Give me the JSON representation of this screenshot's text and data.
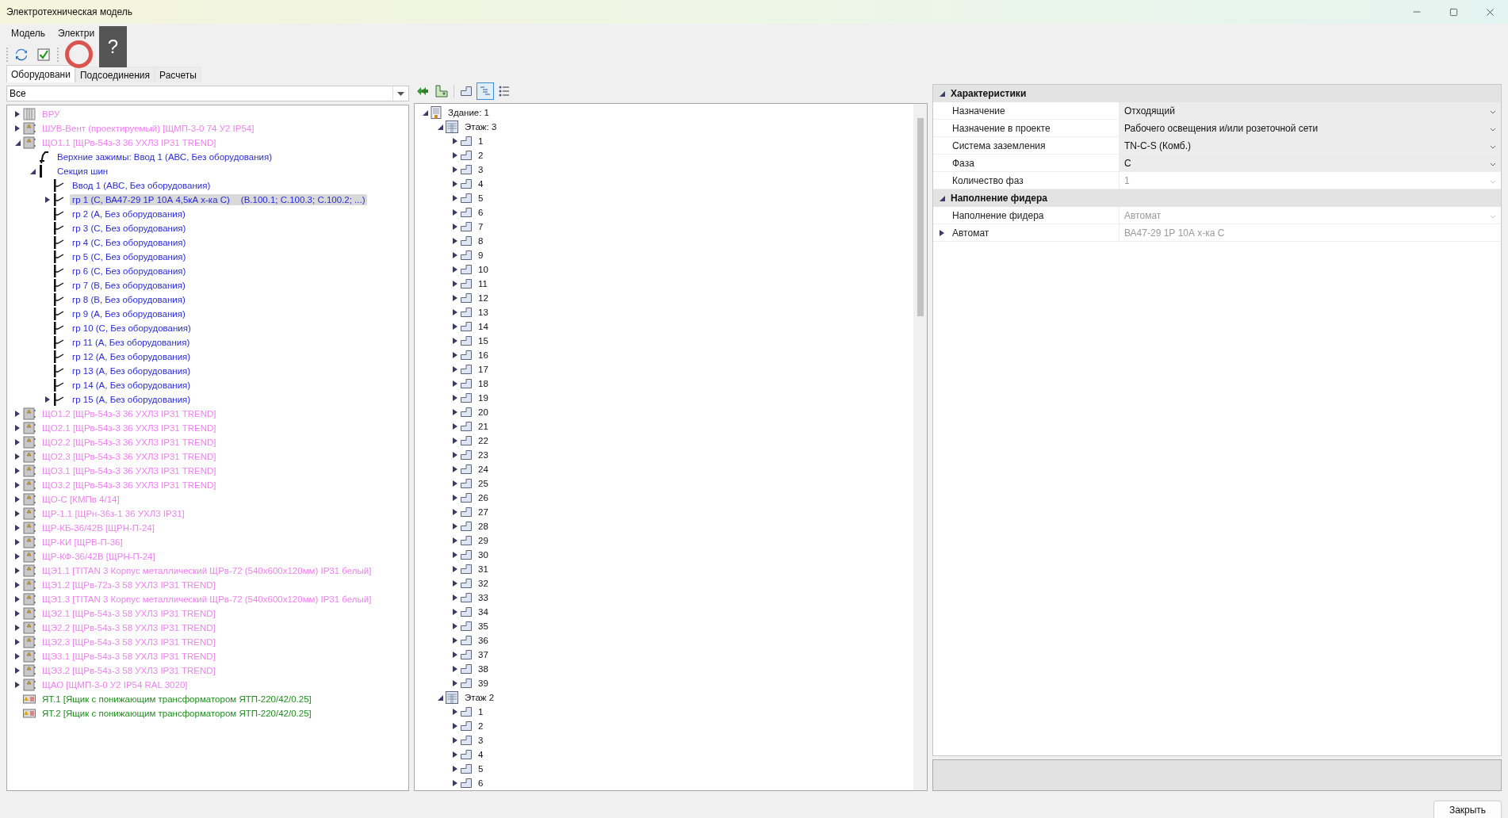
{
  "window": {
    "title": "Электротехническая модель"
  },
  "menu": [
    "Модель",
    "Электри"
  ],
  "overlay": {
    "glyph": "?"
  },
  "tabs": [
    {
      "label": "Оборудовани",
      "selected": true
    },
    {
      "label": "Подсоединения",
      "selected": false
    },
    {
      "label": "Расчеты",
      "selected": false
    }
  ],
  "filter": {
    "value": "Все"
  },
  "equipment_tree": [
    {
      "kind": "switchboard",
      "label": "ВРУ",
      "expanded": false,
      "selected": false
    },
    {
      "kind": "cabinet",
      "label": "ШУВ-Вент (проектируемый) [ЩМП-3-0 74 У2 IP54]",
      "expanded": false,
      "selected": false
    },
    {
      "kind": "cabinet",
      "label": "ЩО1.1 [ЩРв-54з-3 36 УХЛ3 IP31 TREND]",
      "expanded": true,
      "selected": false,
      "children": [
        {
          "kind": "terminal",
          "label": "Верхние зажимы: Ввод 1 (АВС, Без оборудования)",
          "selected": false
        },
        {
          "kind": "busbar",
          "label": "Секция шин",
          "expanded": true,
          "selected": false,
          "children": [
            {
              "kind": "feeder",
              "label": "Ввод 1 (АВС, Без оборудования)",
              "selected": false
            },
            {
              "kind": "feeder",
              "label": "гр 1 (С, ВА47-29 1Р 10А 4,5кА х-ка С)",
              "note": "(B.100.1; C.100.3; C.100.2; ...)",
              "expanded": false,
              "selected": true
            },
            {
              "kind": "feeder",
              "label": "гр 2 (А, Без оборудования)",
              "selected": false
            },
            {
              "kind": "feeder",
              "label": "гр 3 (С, Без оборудования)",
              "selected": false
            },
            {
              "kind": "feeder",
              "label": "гр 4 (С, Без оборудования)",
              "selected": false
            },
            {
              "kind": "feeder",
              "label": "гр 5 (С, Без оборудования)",
              "selected": false
            },
            {
              "kind": "feeder",
              "label": "гр 6 (С, Без оборудования)",
              "selected": false
            },
            {
              "kind": "feeder",
              "label": "гр 7 (В, Без оборудования)",
              "selected": false
            },
            {
              "kind": "feeder",
              "label": "гр 8 (В, Без оборудования)",
              "selected": false
            },
            {
              "kind": "feeder",
              "label": "гр 9 (А, Без оборудования)",
              "selected": false
            },
            {
              "kind": "feeder",
              "label": "гр 10 (С, Без оборудования)",
              "selected": false
            },
            {
              "kind": "feeder",
              "label": "гр 11 (А, Без оборудования)",
              "selected": false
            },
            {
              "kind": "feeder",
              "label": "гр 12 (А, Без оборудования)",
              "selected": false
            },
            {
              "kind": "feeder",
              "label": "гр 13 (А, Без оборудования)",
              "selected": false
            },
            {
              "kind": "feeder",
              "label": "гр 14 (А, Без оборудования)",
              "selected": false
            },
            {
              "kind": "feeder",
              "label": "гр 15 (А, Без оборудования)",
              "expanded": false,
              "selected": false
            }
          ]
        }
      ]
    },
    {
      "kind": "cabinet",
      "label": "ЩО1.2 [ЩРв-54з-3 36 УХЛ3 IP31 TREND]",
      "expanded": false,
      "selected": false
    },
    {
      "kind": "cabinet",
      "label": "ЩО2.1 [ЩРв-54з-3 36 УХЛ3 IP31 TREND]",
      "expanded": false,
      "selected": false
    },
    {
      "kind": "cabinet",
      "label": "ЩО2.2 [ЩРв-54з-3 36 УХЛ3 IP31 TREND]",
      "expanded": false,
      "selected": false
    },
    {
      "kind": "cabinet",
      "label": "ЩО2.3 [ЩРв-54з-3 36 УХЛ3 IP31 TREND]",
      "expanded": false,
      "selected": false
    },
    {
      "kind": "cabinet",
      "label": "ЩО3.1 [ЩРв-54з-3 36 УХЛ3 IP31 TREND]",
      "expanded": false,
      "selected": false
    },
    {
      "kind": "cabinet",
      "label": "ЩО3.2 [ЩРв-54з-3 36 УХЛ3 IP31 TREND]",
      "expanded": false,
      "selected": false
    },
    {
      "kind": "cabinet",
      "label": "ЩО-С [КМПв 4/14]",
      "expanded": false,
      "selected": false
    },
    {
      "kind": "cabinet",
      "label": "ЩР-1.1 [ЩРн-36з-1 36 УХЛ3 IP31]",
      "expanded": false,
      "selected": false
    },
    {
      "kind": "cabinet",
      "label": "ЩР-КБ-36/42В [ЩРН-П-24]",
      "expanded": false,
      "selected": false
    },
    {
      "kind": "cabinet",
      "label": "ЩР-КИ [ЩРВ-П-36]",
      "expanded": false,
      "selected": false
    },
    {
      "kind": "cabinet",
      "label": "ЩР-КФ-36/42В [ЩРН-П-24]",
      "expanded": false,
      "selected": false
    },
    {
      "kind": "cabinet",
      "label": "ЩЭ1.1 [TITAN 3 Корпус металлический ЩРв-72 (540х600х120мм) IP31 белый]",
      "expanded": false,
      "selected": false
    },
    {
      "kind": "cabinet",
      "label": "ЩЭ1.2 [ЩРв-72з-3 58 УХЛ3 IP31 TREND]",
      "expanded": false,
      "selected": false
    },
    {
      "kind": "cabinet",
      "label": "ЩЭ1.3 [TITAN 3 Корпус металлический ЩРв-72 (540х600х120мм) IP31 белый]",
      "expanded": false,
      "selected": false
    },
    {
      "kind": "cabinet",
      "label": "ЩЭ2.1 [ЩРв-54з-3 58 УХЛ3 IP31 TREND]",
      "expanded": false,
      "selected": false
    },
    {
      "kind": "cabinet",
      "label": "ЩЭ2.2 [ЩРв-54з-3 58 УХЛ3 IP31 TREND]",
      "expanded": false,
      "selected": false
    },
    {
      "kind": "cabinet",
      "label": "ЩЭ2.3 [ЩРв-54з-3 58 УХЛ3 IP31 TREND]",
      "expanded": false,
      "selected": false
    },
    {
      "kind": "cabinet",
      "label": "ЩЭ3.1 [ЩРв-54з-3 58 УХЛ3 IP31 TREND]",
      "expanded": false,
      "selected": false
    },
    {
      "kind": "cabinet",
      "label": "ЩЭ3.2 [ЩРв-54з-3 58 УХЛ3 IP31 TREND]",
      "expanded": false,
      "selected": false
    },
    {
      "kind": "cabinet",
      "label": "ЩАО [ЩМП-3-0 У2 IP54 RAL 3020]",
      "expanded": false,
      "selected": false
    },
    {
      "kind": "transformer",
      "label": "ЯТ.1 [Ящик с понижающим трансформатором ЯТП-220/42/0.25]",
      "selected": false
    },
    {
      "kind": "transformer",
      "label": "ЯТ.2 [Ящик с понижающим трансформатором ЯТП-220/42/0.25]",
      "selected": false
    }
  ],
  "building_toolbar": [
    {
      "kind": "collapse",
      "selected": false
    },
    {
      "kind": "add",
      "selected": false
    },
    {
      "kind": "room",
      "selected": false
    },
    {
      "kind": "tree",
      "selected": true
    },
    {
      "kind": "list",
      "selected": false
    }
  ],
  "building_tree": [
    {
      "kind": "building",
      "label": "Здание: 1",
      "expanded": true,
      "selected": false,
      "children": [
        {
          "kind": "floor",
          "label": "Этаж: 3",
          "expanded": true,
          "selected": false,
          "children": [
            {
              "kind": "room",
              "label": "1",
              "expanded": false,
              "selected": false
            },
            {
              "kind": "room",
              "label": "2",
              "expanded": false,
              "selected": false
            },
            {
              "kind": "room",
              "label": "3",
              "expanded": false,
              "selected": false
            },
            {
              "kind": "room",
              "label": "4",
              "expanded": false,
              "selected": false
            },
            {
              "kind": "room",
              "label": "5",
              "expanded": false,
              "selected": false
            },
            {
              "kind": "room",
              "label": "6",
              "expanded": false,
              "selected": false
            },
            {
              "kind": "room",
              "label": "7",
              "expanded": false,
              "selected": false
            },
            {
              "kind": "room",
              "label": "8",
              "expanded": false,
              "selected": false
            },
            {
              "kind": "room",
              "label": "9",
              "expanded": false,
              "selected": false
            },
            {
              "kind": "room",
              "label": "10",
              "expanded": false,
              "selected": false
            },
            {
              "kind": "room",
              "label": "11",
              "expanded": false,
              "selected": false
            },
            {
              "kind": "room",
              "label": "12",
              "expanded": false,
              "selected": false
            },
            {
              "kind": "room",
              "label": "13",
              "expanded": false,
              "selected": false
            },
            {
              "kind": "room",
              "label": "14",
              "expanded": false,
              "selected": false
            },
            {
              "kind": "room",
              "label": "15",
              "expanded": false,
              "selected": false
            },
            {
              "kind": "room",
              "label": "16",
              "expanded": false,
              "selected": false
            },
            {
              "kind": "room",
              "label": "17",
              "expanded": false,
              "selected": false
            },
            {
              "kind": "room",
              "label": "18",
              "expanded": false,
              "selected": false
            },
            {
              "kind": "room",
              "label": "19",
              "expanded": false,
              "selected": false
            },
            {
              "kind": "room",
              "label": "20",
              "expanded": false,
              "selected": false
            },
            {
              "kind": "room",
              "label": "21",
              "expanded": false,
              "selected": false
            },
            {
              "kind": "room",
              "label": "22",
              "expanded": false,
              "selected": false
            },
            {
              "kind": "room",
              "label": "23",
              "expanded": false,
              "selected": false
            },
            {
              "kind": "room",
              "label": "24",
              "expanded": false,
              "selected": false
            },
            {
              "kind": "room",
              "label": "25",
              "expanded": false,
              "selected": false
            },
            {
              "kind": "room",
              "label": "26",
              "expanded": false,
              "selected": false
            },
            {
              "kind": "room",
              "label": "27",
              "expanded": false,
              "selected": false
            },
            {
              "kind": "room",
              "label": "28",
              "expanded": false,
              "selected": false
            },
            {
              "kind": "room",
              "label": "29",
              "expanded": false,
              "selected": false
            },
            {
              "kind": "room",
              "label": "30",
              "expanded": false,
              "selected": false
            },
            {
              "kind": "room",
              "label": "31",
              "expanded": false,
              "selected": false
            },
            {
              "kind": "room",
              "label": "32",
              "expanded": false,
              "selected": false
            },
            {
              "kind": "room",
              "label": "33",
              "expanded": false,
              "selected": false
            },
            {
              "kind": "room",
              "label": "34",
              "expanded": false,
              "selected": false
            },
            {
              "kind": "room",
              "label": "35",
              "expanded": false,
              "selected": false
            },
            {
              "kind": "room",
              "label": "36",
              "expanded": false,
              "selected": false
            },
            {
              "kind": "room",
              "label": "37",
              "expanded": false,
              "selected": false
            },
            {
              "kind": "room",
              "label": "38",
              "expanded": false,
              "selected": false
            },
            {
              "kind": "room",
              "label": "39",
              "expanded": false,
              "selected": false
            }
          ]
        },
        {
          "kind": "floor",
          "label": "Этаж 2",
          "expanded": true,
          "selected": false,
          "children": [
            {
              "kind": "room",
              "label": "1",
              "expanded": false,
              "selected": false
            },
            {
              "kind": "room",
              "label": "2",
              "expanded": false,
              "selected": false
            },
            {
              "kind": "room",
              "label": "3",
              "expanded": false,
              "selected": false
            },
            {
              "kind": "room",
              "label": "4",
              "expanded": false,
              "selected": false
            },
            {
              "kind": "room",
              "label": "5",
              "expanded": false,
              "selected": false
            },
            {
              "kind": "room",
              "label": "6",
              "expanded": false,
              "selected": false
            }
          ]
        }
      ]
    }
  ],
  "properties": [
    {
      "category": "Характеристики",
      "expanded": true,
      "rows": [
        {
          "label": "Назначение",
          "value": "Отходящий",
          "disabled": false
        },
        {
          "label": "Назначение в проекте",
          "value": "Рабочего освещения и/или розеточной сети",
          "disabled": false
        },
        {
          "label": "Система заземления",
          "value": "TN-C-S (Комб.)",
          "disabled": false
        },
        {
          "label": "Фаза",
          "value": "С",
          "disabled": false
        },
        {
          "label": "Количество фаз",
          "value": "1",
          "disabled": true
        }
      ]
    },
    {
      "category": "Наполнение фидера",
      "expanded": true,
      "rows": [
        {
          "label": "Наполнение фидера",
          "value": "Автомат",
          "disabled": true
        },
        {
          "label": "Автомат",
          "value": "ВА47-29 1Р 10А  х-ка С",
          "disabled": true,
          "kind": "expandable",
          "expanded": false
        }
      ]
    }
  ],
  "close_button": "Закрыть"
}
